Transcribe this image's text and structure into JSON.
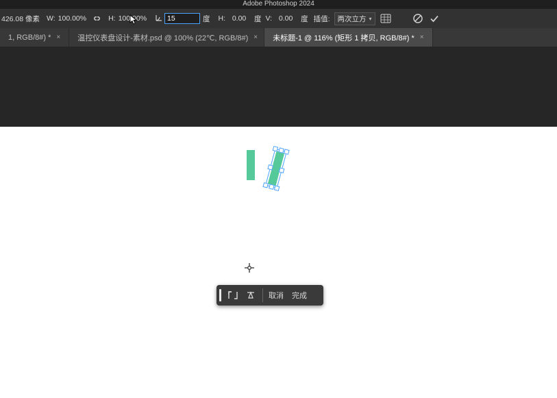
{
  "app_title": "Adobe Photoshop 2024",
  "options": {
    "x_value": "426.08 像素",
    "w_label": "W:",
    "w_value": "100.00%",
    "h_label": "H:",
    "h_value": "100.00%",
    "angle_value": "15",
    "deg1": "度",
    "h2_label": "H:",
    "h2_value": "0.00",
    "deg2": "度",
    "v_label": "V:",
    "v_value": "0.00",
    "deg3": "度",
    "interp_label": "插值:",
    "interp_value": "两次立方"
  },
  "tabs": [
    {
      "label": "1, RGB/8#) *"
    },
    {
      "label": "温控仪表盘设计-素材.psd @ 100% (22℃, RGB/8#)"
    },
    {
      "label": "未标题-1 @ 116% (矩形 1 拷贝, RGB/8#) *"
    }
  ],
  "floatbar": {
    "cancel": "取消",
    "done": "完成"
  }
}
